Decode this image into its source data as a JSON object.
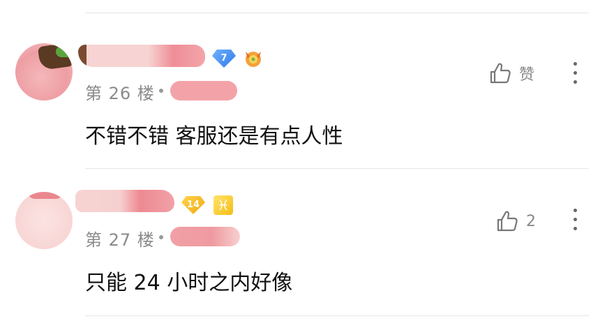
{
  "comments": [
    {
      "floor": "第 26 楼",
      "level": "7",
      "content": "不错不错 客服还是有点人性",
      "like_label": "赞"
    },
    {
      "floor": "第 27 楼",
      "level": "14",
      "zodiac": "♓",
      "content": "只能 24 小时之内好像",
      "like_label": "2"
    }
  ],
  "colors": {
    "divider": "#e6e6e6",
    "secondary_text": "#8a8a8a",
    "badge_blue": "#2f7be8",
    "badge_gold": "#f0a90f"
  },
  "icons": [
    "thumbs-up-icon",
    "more-vertical-icon",
    "level-diamond-icon",
    "medal-icon",
    "pisces-icon"
  ]
}
